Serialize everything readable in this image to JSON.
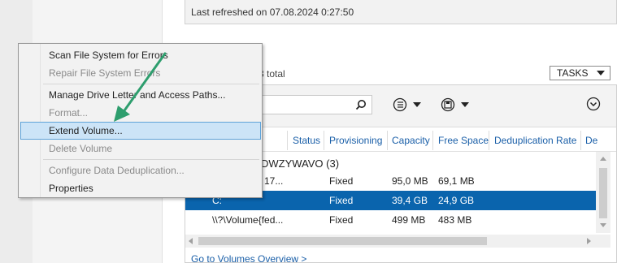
{
  "header": {
    "last_refreshed": "Last refreshed on 07.08.2024 0:27:50"
  },
  "volumes": {
    "total_text": "3 total",
    "tasks_label": "TASKS",
    "columns": [
      "Status",
      "Provisioning",
      "Capacity",
      "Free Space",
      "Deduplication Rate",
      "De"
    ],
    "group_label": "DWZYWAVO (3)",
    "rows": [
      {
        "volume": "17...",
        "provisioning": "Fixed",
        "capacity": "95,0 MB",
        "free_space": "69,1 MB"
      },
      {
        "volume": "C:",
        "provisioning": "Fixed",
        "capacity": "39,4 GB",
        "free_space": "24,9 GB"
      },
      {
        "volume": "\\\\?\\Volume{fed...",
        "provisioning": "Fixed",
        "capacity": "499 MB",
        "free_space": "483 MB"
      }
    ],
    "goto_link": "Go to Volumes Overview >"
  },
  "context_menu": {
    "items": [
      {
        "label": "Scan File System for Errors",
        "enabled": true
      },
      {
        "label": "Repair File System Errors",
        "enabled": false
      },
      {
        "label": "Manage Drive Letter and Access Paths...",
        "enabled": true
      },
      {
        "label": "Format...",
        "enabled": false
      },
      {
        "label": "Extend Volume...",
        "enabled": true,
        "highlighted": true
      },
      {
        "label": "Delete Volume",
        "enabled": false
      },
      {
        "label": "Configure Data Deduplication...",
        "enabled": false
      },
      {
        "label": "Properties",
        "enabled": true
      }
    ]
  },
  "colors": {
    "selection": "#0a64ad",
    "link": "#1a5fa8",
    "highlight": "#cce4f7",
    "arrow": "#2e9e6e"
  }
}
